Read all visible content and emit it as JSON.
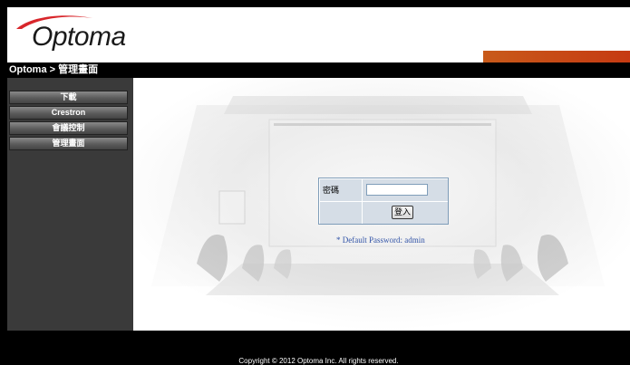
{
  "brand": {
    "logo_text": "Optoma"
  },
  "breadcrumb": "Optoma > 管理畫面",
  "sidebar": {
    "items": [
      {
        "label": "下載"
      },
      {
        "label": "Crestron"
      },
      {
        "label": "會議控制"
      },
      {
        "label": "管理畫面"
      }
    ]
  },
  "login": {
    "password_label": "密碼",
    "password_value": "",
    "submit_label": "登入",
    "hint": "* Default Password: admin"
  },
  "footer": {
    "copyright": "Copyright © 2012 Optoma Inc. All rights reserved."
  },
  "colors": {
    "accent_orange": "#c85a1a",
    "hint_blue": "#3355a8",
    "sidebar": "#3a3a3a"
  }
}
